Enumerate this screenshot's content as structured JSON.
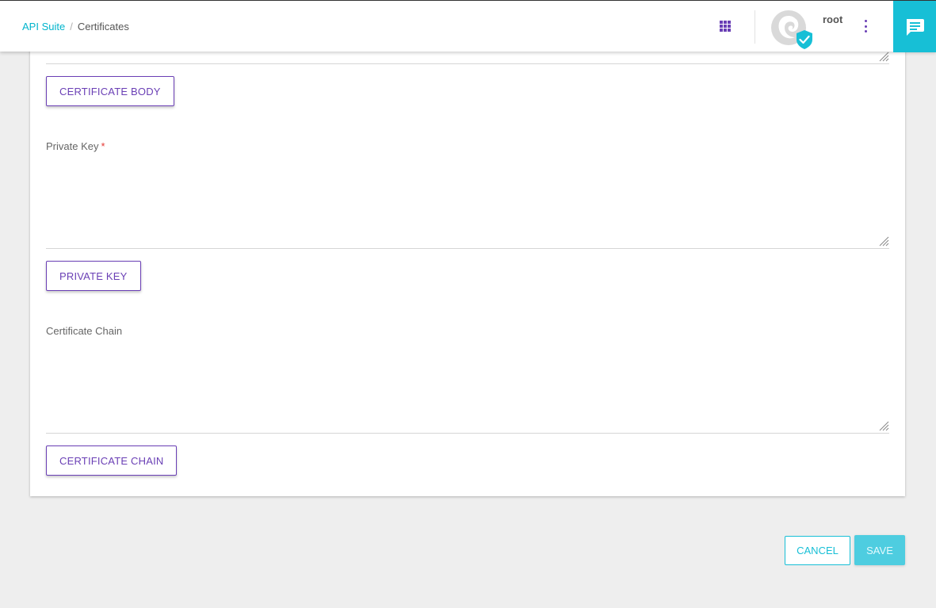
{
  "header": {
    "breadcrumb": {
      "root": "API Suite",
      "separator": "/",
      "current": "Certificates"
    },
    "user": {
      "name": "root"
    },
    "icons": {
      "apps": "apps-grid-icon",
      "avatar": "user-avatar-verified-icon",
      "menu": "more-vert-icon",
      "chat": "chat-message-icon"
    }
  },
  "form": {
    "certificate_body": {
      "value": "",
      "button_label": "CERTIFICATE BODY"
    },
    "private_key": {
      "label": "Private Key",
      "required_marker": "*",
      "value": "",
      "button_label": "PRIVATE KEY"
    },
    "certificate_chain": {
      "label": "Certificate Chain",
      "value": "",
      "button_label": "CERTIFICATE CHAIN"
    }
  },
  "actions": {
    "cancel_label": "CANCEL",
    "save_label": "SAVE"
  },
  "colors": {
    "accent_teal": "#17bfd6",
    "accent_purple": "#6a3fb5",
    "required_red": "#e53935",
    "page_background": "#eeeeee"
  }
}
